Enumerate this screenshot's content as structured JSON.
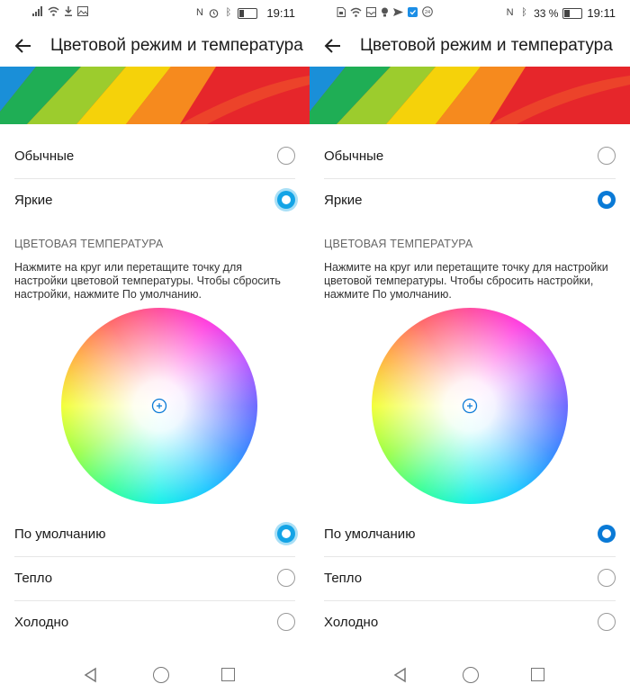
{
  "screens": [
    {
      "status": {
        "left_icons": [
          "signal-icon",
          "wifi-icon",
          "download-icon",
          "image-icon"
        ],
        "battery_pct": "",
        "battery_level": 0.3,
        "time": "19:11"
      },
      "title": "Цветовой режим и температура",
      "mode_options": [
        {
          "label": "Обычные",
          "checked": false
        },
        {
          "label": "Яркие",
          "checked": true
        }
      ],
      "section_title": "ЦВЕТОВАЯ ТЕМПЕРАТУРА",
      "description": "Нажмите на круг или перетащите точку для настройки цветовой температуры. Чтобы сбросить настройки, нажмите По умолчанию.",
      "temp_options": [
        {
          "label": "По умолчанию",
          "checked": true
        },
        {
          "label": "Тепло",
          "checked": false
        },
        {
          "label": "Холодно",
          "checked": false
        }
      ]
    },
    {
      "status": {
        "left_icons": [
          "sim-icon",
          "wifi-icon",
          "tray-icon",
          "bulb-icon",
          "send-icon",
          "app-icon",
          "badge-24-icon"
        ],
        "battery_pct": "33 %",
        "battery_level": 0.33,
        "time": "19:11"
      },
      "title": "Цветовой режим и температура",
      "mode_options": [
        {
          "label": "Обычные",
          "checked": false
        },
        {
          "label": "Яркие",
          "checked": true
        }
      ],
      "section_title": "ЦВЕТОВАЯ ТЕМПЕРАТУРА",
      "description": "Нажмите на круг или перетащите точку для настройки цветовой температуры. Чтобы сбросить настройки, нажмите По умолчанию.",
      "temp_options": [
        {
          "label": "По умолчанию",
          "checked": true
        },
        {
          "label": "Тепло",
          "checked": false
        },
        {
          "label": "Холодно",
          "checked": false
        }
      ]
    }
  ],
  "colors": {
    "accent": "#0a7ad6",
    "accent_soft": "#14a4e6",
    "text": "#1a1a1a",
    "muted": "#666666"
  }
}
